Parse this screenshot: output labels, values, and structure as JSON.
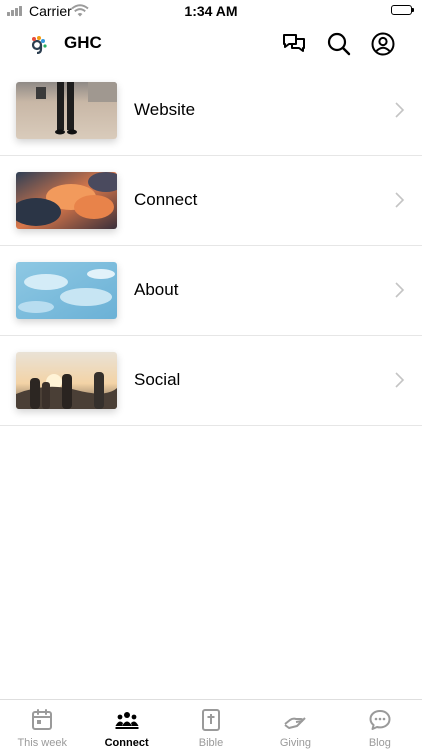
{
  "status_bar": {
    "carrier": "Carrier",
    "time": "1:34 AM"
  },
  "header": {
    "title": "GHC",
    "actions": [
      {
        "icon": "chat-bubbles-icon"
      },
      {
        "icon": "search-icon"
      },
      {
        "icon": "account-icon"
      }
    ]
  },
  "menu": {
    "items": [
      {
        "label": "Website",
        "thumbnail": "person-on-pavement-image"
      },
      {
        "label": "Connect",
        "thumbnail": "sunset-clouds-image"
      },
      {
        "label": "About",
        "thumbnail": "blue-sky-clouds-image"
      },
      {
        "label": "Social",
        "thumbnail": "friends-at-sunset-image"
      }
    ]
  },
  "tab_bar": {
    "tabs": [
      {
        "label": "This week",
        "icon": "calendar-icon",
        "active": false
      },
      {
        "label": "Connect",
        "icon": "people-group-icon",
        "active": true
      },
      {
        "label": "Bible",
        "icon": "bible-icon",
        "active": false
      },
      {
        "label": "Giving",
        "icon": "hand-giving-icon",
        "active": false
      },
      {
        "label": "Blog",
        "icon": "speech-bubble-icon",
        "active": false
      }
    ]
  },
  "colors": {
    "active_tab": "#000000",
    "inactive_tab": "#9a9a9a",
    "divider": "#e6e6e6"
  }
}
